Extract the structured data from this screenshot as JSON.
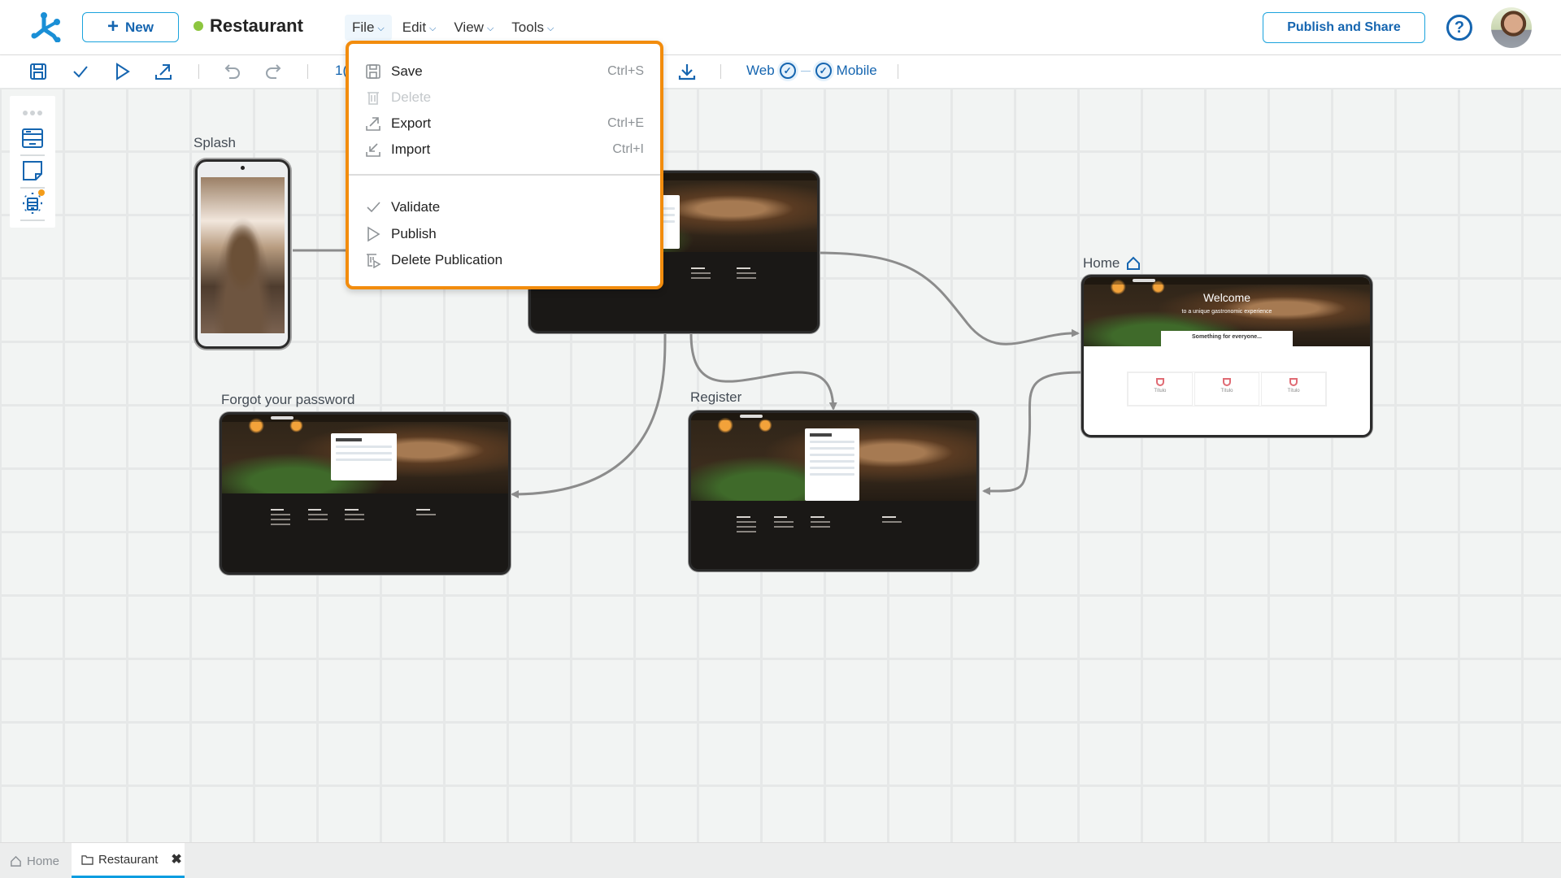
{
  "header": {
    "new_button": "New",
    "project_name": "Restaurant",
    "project_status_color": "#8dc63f",
    "menus": [
      "File",
      "Edit",
      "View",
      "Tools"
    ],
    "publish_share": "Publish and Share",
    "help_icon": "?",
    "accent_color": "#1565b0"
  },
  "toolbar": {
    "icons": [
      "save-icon",
      "validate-icon",
      "run-icon",
      "export-icon",
      "undo-icon",
      "redo-icon",
      "download-icon"
    ],
    "zoom_partial": "1(",
    "platforms": {
      "web": "Web",
      "mobile": "Mobile"
    }
  },
  "file_menu": {
    "items": [
      {
        "label": "Save",
        "shortcut": "Ctrl+S",
        "icon": "save-icon",
        "disabled": false
      },
      {
        "label": "Delete",
        "shortcut": "",
        "icon": "trash-icon",
        "disabled": true
      },
      {
        "label": "Export",
        "shortcut": "Ctrl+E",
        "icon": "export-icon",
        "disabled": false
      },
      {
        "label": "Import",
        "shortcut": "Ctrl+I",
        "icon": "import-icon",
        "disabled": false
      },
      {
        "label": "Validate",
        "shortcut": "",
        "icon": "check-icon",
        "disabled": false
      },
      {
        "label": "Publish",
        "shortcut": "",
        "icon": "play-icon",
        "disabled": false
      },
      {
        "label": "Delete Publication",
        "shortcut": "",
        "icon": "delete-publication-icon",
        "disabled": false
      }
    ],
    "highlight_color": "#f28c0d"
  },
  "palette": {
    "items": [
      "web-page-icon",
      "note-icon",
      "process-icon"
    ]
  },
  "canvas": {
    "nodes": {
      "splash": {
        "label": "Splash"
      },
      "login": {
        "label": ""
      },
      "home": {
        "label": "Home",
        "welcome": "Welcome",
        "subtitle": "to a unique gastronomic experience",
        "section": "Something for everyone...",
        "cards": [
          "Título",
          "Título",
          "Título"
        ]
      },
      "forgot": {
        "label": "Forgot your password",
        "card_title": "Recover password"
      },
      "register": {
        "label": "Register",
        "card_title": "Register"
      }
    }
  },
  "tabs": {
    "home": "Home",
    "active": "Restaurant"
  }
}
